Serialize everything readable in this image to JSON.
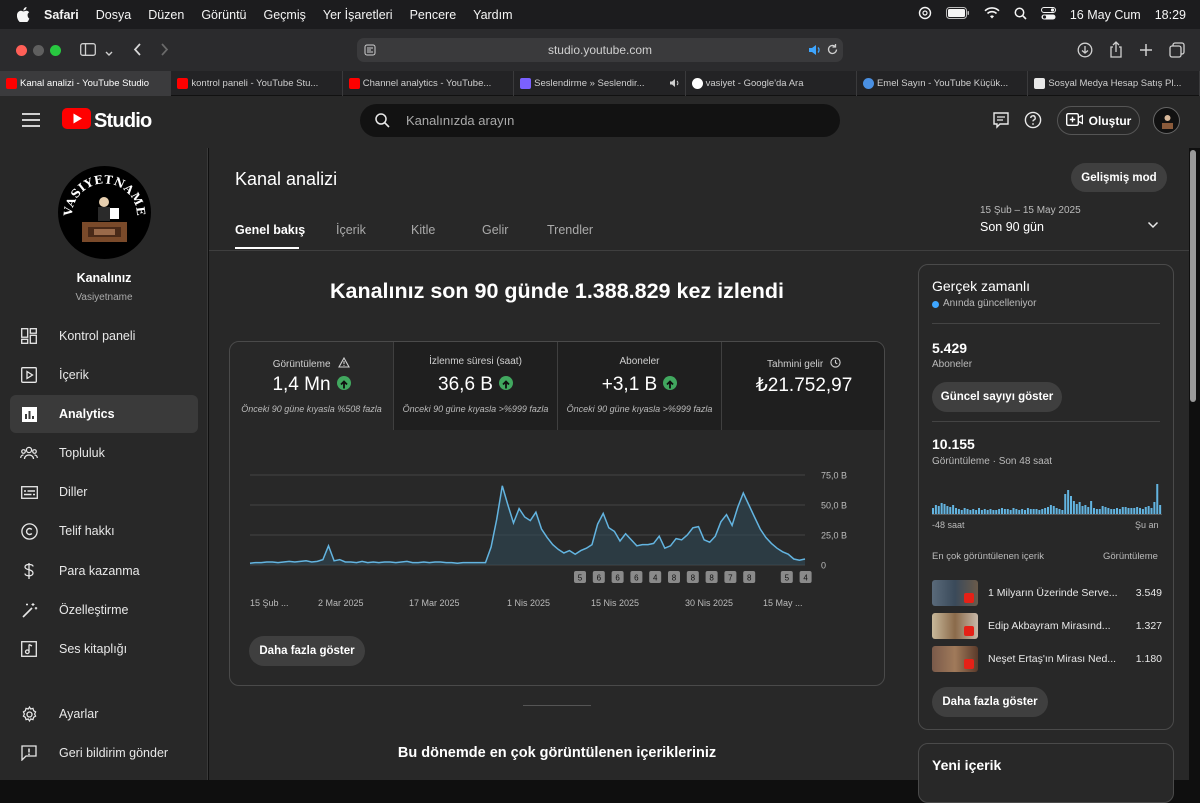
{
  "menubar": {
    "app": "Safari",
    "items": [
      "Dosya",
      "Düzen",
      "Görüntü",
      "Geçmiş",
      "Yer İşaretleri",
      "Pencere",
      "Yardım"
    ],
    "date": "16 May Cum",
    "time": "18:29"
  },
  "browser": {
    "url": "studio.youtube.com",
    "tabs": [
      {
        "title": "Kanal analizi - YouTube Studio",
        "active": true
      },
      {
        "title": "kontrol paneli - YouTube Stu..."
      },
      {
        "title": "Channel analytics - YouTube..."
      },
      {
        "title": "Seslendirme » Seslendir..."
      },
      {
        "title": "vasiyet - Google'da Ara"
      },
      {
        "title": "Emel Sayın - YouTube Küçük..."
      },
      {
        "title": "Sosyal Medya Hesap Satış Pl..."
      }
    ]
  },
  "header": {
    "logo_text": "Studio",
    "search_placeholder": "Kanalınızda arayın",
    "create_label": "Oluştur"
  },
  "sidebar": {
    "channel_title": "Kanalınız",
    "channel_name": "Vasiyetname",
    "avatar_text": "VASIYETNAME",
    "items": [
      {
        "label": "Kontrol paneli",
        "icon": "dashboard-icon"
      },
      {
        "label": "İçerik",
        "icon": "content-icon"
      },
      {
        "label": "Analytics",
        "icon": "analytics-icon",
        "active": true
      },
      {
        "label": "Topluluk",
        "icon": "community-icon"
      },
      {
        "label": "Diller",
        "icon": "subtitles-icon"
      },
      {
        "label": "Telif hakkı",
        "icon": "copyright-icon"
      },
      {
        "label": "Para kazanma",
        "icon": "dollar-icon"
      },
      {
        "label": "Özelleştirme",
        "icon": "magic-wand-icon"
      },
      {
        "label": "Ses kitaplığı",
        "icon": "audio-library-icon"
      }
    ],
    "bottom": [
      {
        "label": "Ayarlar",
        "icon": "gear-icon"
      },
      {
        "label": "Geri bildirim gönder",
        "icon": "feedback-icon"
      }
    ]
  },
  "page": {
    "title": "Kanal analizi",
    "advanced_mode": "Gelişmiş mod",
    "tabs": [
      "Genel bakış",
      "İçerik",
      "Kitle",
      "Gelir",
      "Trendler"
    ],
    "date_range": "15 Şub – 15 May 2025",
    "date_period": "Son 90 gün",
    "headline": "Kanalınız son 90 günde 1.388.829 kez izlendi",
    "more_label": "Daha fazla göster",
    "section_title": "Bu dönemde en çok görüntülenen içerikleriniz"
  },
  "metrics": [
    {
      "label": "Görüntüleme",
      "value": "1,4 Mn",
      "compare": "Önceki 90 güne kıyasla %508 fazla",
      "icon": "warning-icon",
      "up": true
    },
    {
      "label": "İzlenme süresi (saat)",
      "value": "36,6 B",
      "compare": "Önceki 90 güne kıyasla >%999 fazla",
      "up": true
    },
    {
      "label": "Aboneler",
      "value": "+3,1 B",
      "compare": "Önceki 90 güne kıyasla >%999 fazla",
      "up": true
    },
    {
      "label": "Tahmini gelir",
      "value": "₺21.752,97",
      "compare": "",
      "icon": "clock-icon"
    }
  ],
  "chart_data": {
    "type": "area",
    "x_tick_labels": [
      "15 Şub ...",
      "2 Mar 2025",
      "17 Mar 2025",
      "1 Nis 2025",
      "15 Nis 2025",
      "30 Nis 2025",
      "15 May ..."
    ],
    "y_tick_labels": [
      "75,0 B",
      "50,0 B",
      "25,0 B",
      "0"
    ],
    "ylim": [
      0,
      75000
    ],
    "grid": true,
    "values": [
      1500,
      2000,
      2000,
      2500,
      2500,
      2000,
      2500,
      3000,
      2500,
      3000,
      3500,
      2500,
      3000,
      4500,
      16000,
      3500,
      4500,
      2500,
      2500,
      2000,
      3000,
      2000,
      2500,
      2000,
      2500,
      2500,
      2000,
      2500,
      3000,
      2000,
      2000,
      2500,
      2000,
      2500,
      2500,
      2000,
      2000,
      1500,
      2000,
      2000,
      2000,
      2000,
      2000,
      15000,
      38000,
      66000,
      50000,
      35000,
      47000,
      40000,
      37000,
      44000,
      30000,
      23000,
      17000,
      13000,
      10000,
      12000,
      9000,
      12000,
      14000,
      17000,
      34000,
      43000,
      31000,
      28000,
      20000,
      26000,
      21000,
      16000,
      17000,
      17000,
      18000,
      24000,
      14000,
      16000,
      22000,
      21000,
      25000,
      31000,
      32000,
      21000,
      19000,
      24000,
      36000,
      42000,
      33000,
      48000,
      60000,
      50000,
      40000,
      30000,
      23000,
      18000,
      14000,
      11000,
      9000,
      5000,
      4000,
      5000
    ],
    "markers": [
      "5",
      "6",
      "6",
      "6",
      "4",
      "8",
      "8",
      "8",
      "7",
      "8",
      "5",
      "4"
    ]
  },
  "realtime": {
    "title": "Gerçek zamanlı",
    "live_text": "Anında güncelleniyor",
    "subs_value": "5.429",
    "subs_label": "Aboneler",
    "show_count": "Güncel sayıyı göster",
    "views_value": "10.155",
    "views_label": "Görüntüleme · Son 48 saat",
    "x_left": "-48 saat",
    "x_right": "Şu an",
    "bar_values": [
      6,
      9,
      8,
      11,
      10,
      8,
      7,
      9,
      6,
      5,
      4,
      6,
      5,
      4,
      5,
      4,
      6,
      4,
      5,
      4,
      5,
      4,
      4,
      5,
      6,
      5,
      5,
      4,
      6,
      5,
      4,
      5,
      4,
      6,
      5,
      5,
      5,
      4,
      5,
      6,
      7,
      9,
      8,
      6,
      5,
      4,
      20,
      24,
      18,
      13,
      10,
      12,
      8,
      9,
      7,
      13,
      6,
      5,
      5,
      8,
      7,
      6,
      5,
      5,
      6,
      5,
      7,
      7,
      6,
      6,
      6,
      7,
      6,
      5,
      7,
      8,
      6,
      12,
      30,
      9
    ],
    "top_header_left": "En çok görüntülenen içerik",
    "top_header_right": "Görüntüleme",
    "top_items": [
      {
        "title": "1 Milyarın Üzerinde Serve...",
        "views": "3.549"
      },
      {
        "title": "Edip Akbayram Mirasınd...",
        "views": "1.327"
      },
      {
        "title": "Neşet Ertaş'ın Mirası Ned...",
        "views": "1.180"
      }
    ],
    "more_label": "Daha fazla göster"
  },
  "new_content": {
    "title": "Yeni içerik"
  },
  "colors": {
    "accent": "#3ea6ff",
    "brand": "#ff0000",
    "up": "#41a85f",
    "chart_line": "#63b4e0"
  }
}
